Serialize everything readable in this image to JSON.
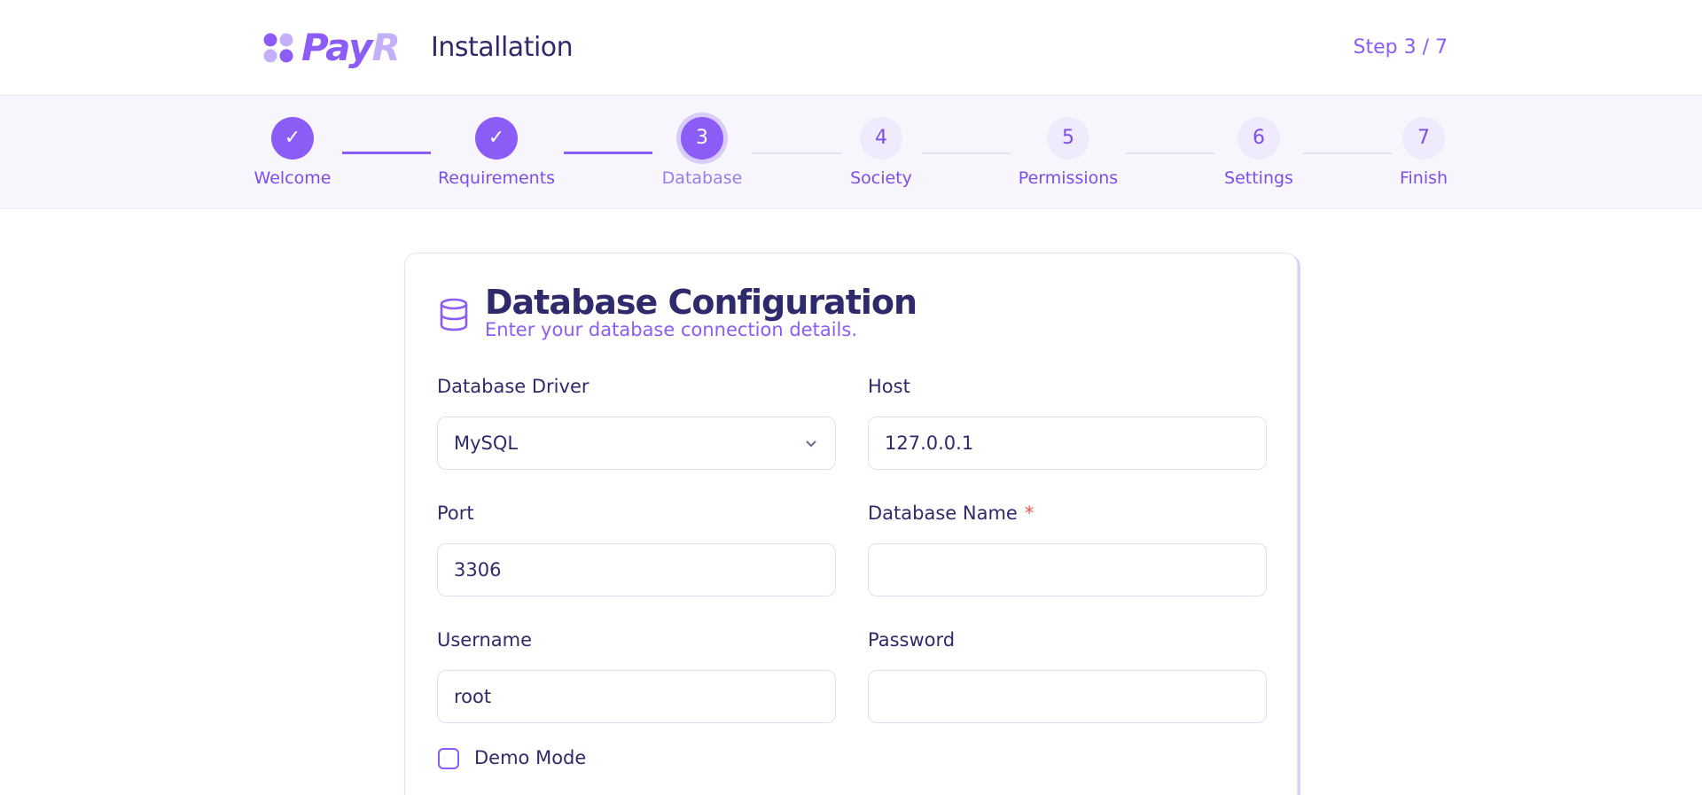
{
  "header": {
    "brand_pay": "Pay",
    "brand_r": "R",
    "title": "Installation",
    "step_counter": "Step 3 / 7"
  },
  "stepper": {
    "steps": [
      {
        "label": "Welcome",
        "symbol": "✓",
        "state": "done"
      },
      {
        "label": "Requirements",
        "symbol": "✓",
        "state": "done"
      },
      {
        "label": "Database",
        "symbol": "3",
        "state": "active"
      },
      {
        "label": "Society",
        "symbol": "4",
        "state": "todo"
      },
      {
        "label": "Permissions",
        "symbol": "5",
        "state": "todo"
      },
      {
        "label": "Settings",
        "symbol": "6",
        "state": "todo"
      },
      {
        "label": "Finish",
        "symbol": "7",
        "state": "todo"
      }
    ]
  },
  "card": {
    "title": "Database Configuration",
    "subtitle": "Enter your database connection details.",
    "icon": "database-icon"
  },
  "form": {
    "driver_label": "Database Driver",
    "driver_value": "MySQL",
    "host_label": "Host",
    "host_value": "127.0.0.1",
    "port_label": "Port",
    "port_value": "3306",
    "dbname_label": "Database Name",
    "dbname_required": "*",
    "dbname_value": "",
    "username_label": "Username",
    "username_value": "root",
    "password_label": "Password",
    "password_value": "",
    "demo_label": "Demo Mode",
    "demo_checked": false
  },
  "colors": {
    "accent": "#8b5cf6",
    "text": "#2e2a6b",
    "required": "#e25555"
  }
}
